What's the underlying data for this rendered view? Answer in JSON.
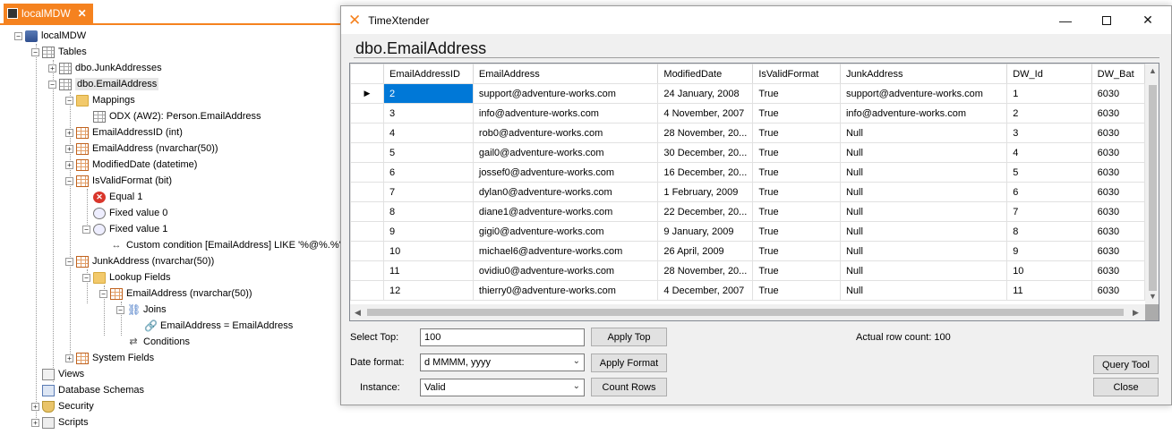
{
  "left_panel": {
    "tab_label": "localMDW",
    "tab_close": "✕",
    "tree": [
      {
        "id": "root",
        "label": "localMDW"
      },
      {
        "id": "tables",
        "label": "Tables"
      },
      {
        "id": "junk",
        "label": "dbo.JunkAddresses"
      },
      {
        "id": "email",
        "label": "dbo.EmailAddress"
      },
      {
        "id": "mappings",
        "label": "Mappings"
      },
      {
        "id": "odx",
        "label": "ODX (AW2): Person.EmailAddress"
      },
      {
        "id": "f_id",
        "label": "EmailAddressID (int)"
      },
      {
        "id": "f_email",
        "label": "EmailAddress (nvarchar(50))"
      },
      {
        "id": "f_mod",
        "label": "ModifiedDate (datetime)"
      },
      {
        "id": "f_valid",
        "label": "IsValidFormat (bit)"
      },
      {
        "id": "equal1",
        "label": "Equal 1"
      },
      {
        "id": "fixed0",
        "label": "Fixed value 0"
      },
      {
        "id": "fixed1",
        "label": "Fixed value 1"
      },
      {
        "id": "custom",
        "label": "Custom condition [EmailAddress] LIKE '%@%.%'"
      },
      {
        "id": "f_junk",
        "label": "JunkAddress (nvarchar(50))"
      },
      {
        "id": "lookup",
        "label": "Lookup Fields"
      },
      {
        "id": "lk_email",
        "label": "EmailAddress (nvarchar(50))"
      },
      {
        "id": "joins",
        "label": "Joins"
      },
      {
        "id": "join1",
        "label": "EmailAddress = EmailAddress"
      },
      {
        "id": "conditions",
        "label": "Conditions"
      },
      {
        "id": "sysfields",
        "label": "System Fields"
      },
      {
        "id": "views",
        "label": "Views"
      },
      {
        "id": "schemas",
        "label": "Database Schemas"
      },
      {
        "id": "security",
        "label": "Security"
      },
      {
        "id": "scripts",
        "label": "Scripts"
      }
    ]
  },
  "dialog": {
    "title": "TimeXtender",
    "heading": "dbo.EmailAddress",
    "grid": {
      "current_row_marker": "▶",
      "columns": [
        "EmailAddressID",
        "EmailAddress",
        "ModifiedDate",
        "IsValidFormat",
        "JunkAddress",
        "DW_Id",
        "DW_Bat"
      ],
      "rows": [
        [
          "2",
          "support@adventure-works.com",
          "24 January, 2008",
          "True",
          "support@adventure-works.com",
          "1",
          "6030"
        ],
        [
          "3",
          "info@adventure-works.com",
          "4 November, 2007",
          "True",
          "info@adventure-works.com",
          "2",
          "6030"
        ],
        [
          "4",
          "rob0@adventure-works.com",
          "28 November, 20...",
          "True",
          "Null",
          "3",
          "6030"
        ],
        [
          "5",
          "gail0@adventure-works.com",
          "30 December, 20...",
          "True",
          "Null",
          "4",
          "6030"
        ],
        [
          "6",
          "jossef0@adventure-works.com",
          "16 December, 20...",
          "True",
          "Null",
          "5",
          "6030"
        ],
        [
          "7",
          "dylan0@adventure-works.com",
          "1 February, 2009",
          "True",
          "Null",
          "6",
          "6030"
        ],
        [
          "8",
          "diane1@adventure-works.com",
          "22 December, 20...",
          "True",
          "Null",
          "7",
          "6030"
        ],
        [
          "9",
          "gigi0@adventure-works.com",
          "9 January, 2009",
          "True",
          "Null",
          "8",
          "6030"
        ],
        [
          "10",
          "michael6@adventure-works.com",
          "26 April, 2009",
          "True",
          "Null",
          "9",
          "6030"
        ],
        [
          "11",
          "ovidiu0@adventure-works.com",
          "28 November, 20...",
          "True",
          "Null",
          "10",
          "6030"
        ],
        [
          "12",
          "thierry0@adventure-works.com",
          "4 December, 2007",
          "True",
          "Null",
          "11",
          "6030"
        ]
      ]
    },
    "select_top": {
      "label": "Select Top:",
      "value": "100",
      "button": "Apply Top"
    },
    "date_format": {
      "label": "Date format:",
      "value": "d MMMM, yyyy",
      "button": "Apply Format"
    },
    "instance": {
      "label": "Instance:",
      "value": "Valid",
      "button": "Count Rows"
    },
    "row_count": "Actual row count: 100",
    "query_tool": "Query Tool",
    "close": "Close"
  },
  "colors": {
    "accent": "#f5821f",
    "selection": "#0078d7"
  }
}
